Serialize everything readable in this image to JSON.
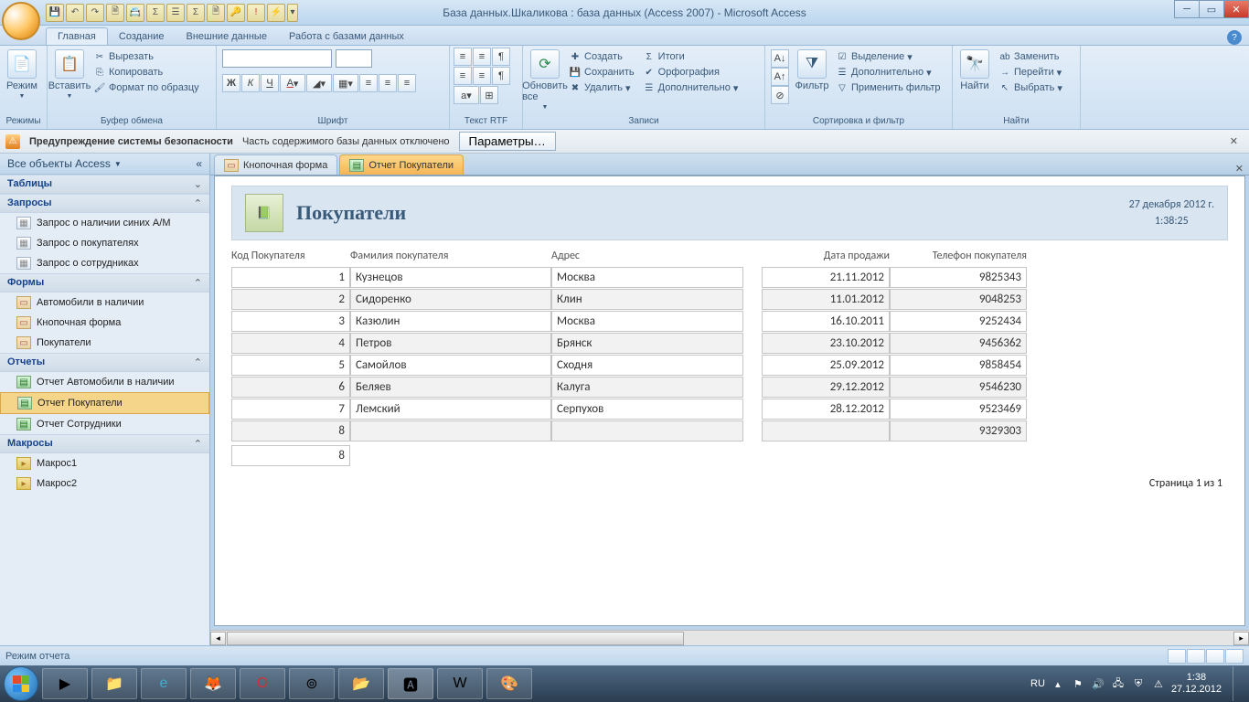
{
  "window": {
    "title": "База данных.Шкаликова : база данных (Access 2007) - Microsoft Access"
  },
  "ribbon_tabs": {
    "t0": "Главная",
    "t1": "Создание",
    "t2": "Внешние данные",
    "t3": "Работа с базами данных"
  },
  "ribbon": {
    "views": "Режимы",
    "view_btn": "Режим",
    "clipboard": "Буфер обмена",
    "paste": "Вставить",
    "cut": "Вырезать",
    "copy": "Копировать",
    "fmt_painter": "Формат по образцу",
    "font": "Шрифт",
    "rtf": "Текст RTF",
    "records": "Записи",
    "refresh": "Обновить все",
    "new": "Создать",
    "save": "Сохранить",
    "delete": "Удалить",
    "totals": "Итоги",
    "spelling": "Орфография",
    "more": "Дополнительно",
    "sort_filter": "Сортировка и фильтр",
    "filter": "Фильтр",
    "selection": "Выделение",
    "advanced": "Дополнительно",
    "toggle_filter": "Применить фильтр",
    "find_grp": "Найти",
    "find": "Найти",
    "replace": "Заменить",
    "goto": "Перейти",
    "select": "Выбрать"
  },
  "security": {
    "title": "Предупреждение системы безопасности",
    "msg": "Часть содержимого базы данных отключено",
    "btn": "Параметры…"
  },
  "nav": {
    "header": "Все объекты Access",
    "tables": "Таблицы",
    "queries": "Запросы",
    "q1": "Запрос о наличии синих А/М",
    "q2": "Запрос о покупателях",
    "q3": "Запрос о сотрудниках",
    "forms": "Формы",
    "f1": "Автомобили в наличии",
    "f2": "Кнопочная форма",
    "f3": "Покупатели",
    "reports": "Отчеты",
    "r1": "Отчет Автомобили в наличии",
    "r2": "Отчет Покупатели",
    "r3": "Отчет Сотрудники",
    "macros": "Макросы",
    "m1": "Макрос1",
    "m2": "Макрос2"
  },
  "tabs": {
    "t1": "Кнопочная форма",
    "t2": "Отчет Покупатели"
  },
  "report": {
    "title": "Покупатели",
    "date": "27 декабря 2012 г.",
    "time": "1:38:25",
    "h_kod": "Код Покупателя",
    "h_fam": "Фамилия покупателя",
    "h_adr": "Адрес",
    "h_dat": "Дата продажи",
    "h_tel": "Телефон покупателя",
    "rows": [
      {
        "kod": "1",
        "fam": "Кузнецов",
        "adr": "Москва",
        "dat": "21.11.2012",
        "tel": "9825343"
      },
      {
        "kod": "2",
        "fam": "Сидоренко",
        "adr": "Клин",
        "dat": "11.01.2012",
        "tel": "9048253"
      },
      {
        "kod": "3",
        "fam": "Казюлин",
        "adr": "Москва",
        "dat": "16.10.2011",
        "tel": "9252434"
      },
      {
        "kod": "4",
        "fam": "Петров",
        "adr": "Брянск",
        "dat": "23.10.2012",
        "tel": "9456362"
      },
      {
        "kod": "5",
        "fam": "Самойлов",
        "adr": "Сходня",
        "dat": "25.09.2012",
        "tel": "9858454"
      },
      {
        "kod": "6",
        "fam": "Беляев",
        "adr": "Калуга",
        "dat": "29.12.2012",
        "tel": "9546230"
      },
      {
        "kod": "7",
        "fam": "Лемский",
        "adr": "Серпухов",
        "dat": "28.12.2012",
        "tel": "9523469"
      },
      {
        "kod": "8",
        "fam": "",
        "adr": "",
        "dat": "",
        "tel": "9329303"
      }
    ],
    "total_count": "8",
    "page": "Страница 1 из 1"
  },
  "status": {
    "mode": "Режим отчета"
  },
  "taskbar": {
    "lang": "RU",
    "time": "1:38",
    "date": "27.12.2012"
  }
}
